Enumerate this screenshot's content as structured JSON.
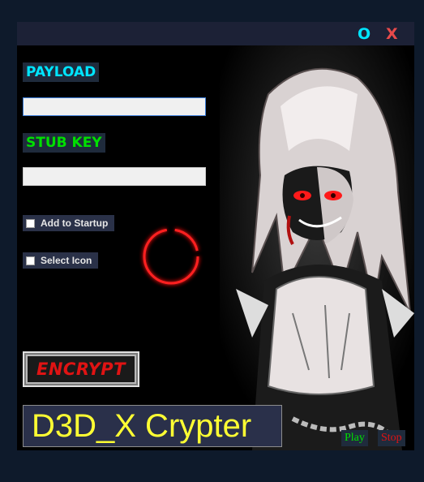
{
  "titlebar": {
    "minimize_label": "O",
    "close_label": "X"
  },
  "form": {
    "payload_label": "PAYLOAD",
    "payload_value": "",
    "stub_key_label": "STUB KEY",
    "stub_key_value": "",
    "add_to_startup_label": "Add to Startup",
    "add_to_startup_checked": false,
    "select_icon_label": "Select Icon",
    "select_icon_checked": false
  },
  "encrypt_label": "ENCRYPT",
  "app_title": "D3D_X Crypter",
  "media": {
    "play_label": "Play",
    "stop_label": "Stop"
  },
  "colors": {
    "payload_label": "#00e5ff",
    "stub_key_label": "#00e000",
    "minimize": "#00e5ff",
    "close": "#e84a4a",
    "encrypt_text": "#e01313",
    "app_title": "#ffff33",
    "play": "#00e000",
    "stop": "#e01313",
    "spinner": "#e01010"
  }
}
